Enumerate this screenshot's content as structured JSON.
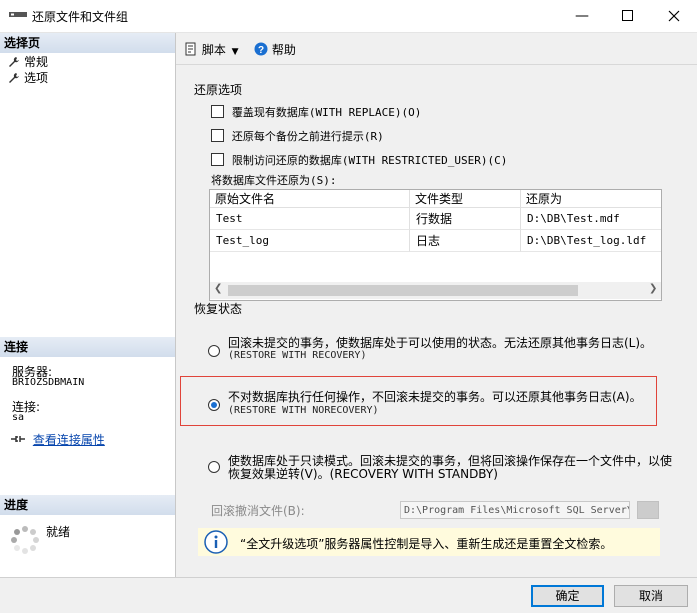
{
  "window": {
    "title": "还原文件和文件组",
    "controls": [
      "minimize",
      "maximize",
      "close"
    ]
  },
  "left": {
    "select_page": {
      "header": "选择页",
      "items": [
        {
          "label": "常规",
          "icon": "wrench-icon"
        },
        {
          "label": "选项",
          "icon": "wrench-icon"
        }
      ]
    },
    "connection": {
      "header": "连接",
      "server_label": "服务器:",
      "server_value": "BRIOZSDBMAIN",
      "conn_label": "连接:",
      "conn_value": "sa",
      "view_props_link": "查看连接属性"
    },
    "progress": {
      "header": "进度",
      "status": "就绪"
    }
  },
  "toolbar": {
    "script_label": "脚本",
    "help_label": "帮助"
  },
  "restore_options": {
    "title": "还原选项",
    "checkboxes": [
      {
        "label": "覆盖现有数据库(WITH REPLACE)(O)",
        "checked": false
      },
      {
        "label": "还原每个备份之前进行提示(R)",
        "checked": false
      },
      {
        "label": "限制访问还原的数据库(WITH RESTRICTED_USER)(C)",
        "checked": false
      }
    ],
    "restore_as_label": "将数据库文件还原为(S):",
    "table": {
      "headers": [
        "原始文件名",
        "文件类型",
        "还原为"
      ],
      "rows": [
        [
          "Test",
          "行数据",
          "D:\\DB\\Test.mdf"
        ],
        [
          "Test_log",
          "日志",
          "D:\\DB\\Test_log.ldf"
        ]
      ]
    }
  },
  "recovery_state": {
    "title": "恢复状态",
    "options": [
      {
        "line1": "回滚未提交的事务，使数据库处于可以使用的状态。无法还原其他事务日志(L)。",
        "line2": "(RESTORE WITH RECOVERY)",
        "selected": false
      },
      {
        "line1": "不对数据库执行任何操作，不回滚未提交的事务。可以还原其他事务日志(A)。",
        "line2": "(RESTORE WITH NORECOVERY)",
        "selected": true
      },
      {
        "line1": "使数据库处于只读模式。回滚未提交的事务，但将回滚操作保存在一个文件中，以使",
        "line2": "恢复效果逆转(V)。(RECOVERY WITH STANDBY)",
        "selected": false
      }
    ],
    "undo_file_label": "回滚撤消文件(B):",
    "undo_file_value": "D:\\Program Files\\Microsoft SQL Server\\"
  },
  "info_banner": "“全文升级选项”服务器属性控制是导入、重新生成还是重置全文检索。",
  "buttons": {
    "ok": "确定",
    "cancel": "取消"
  },
  "colors": {
    "accent": "#0078d7",
    "highlight_border": "#e0443a",
    "info_bg": "#fffbdd"
  }
}
